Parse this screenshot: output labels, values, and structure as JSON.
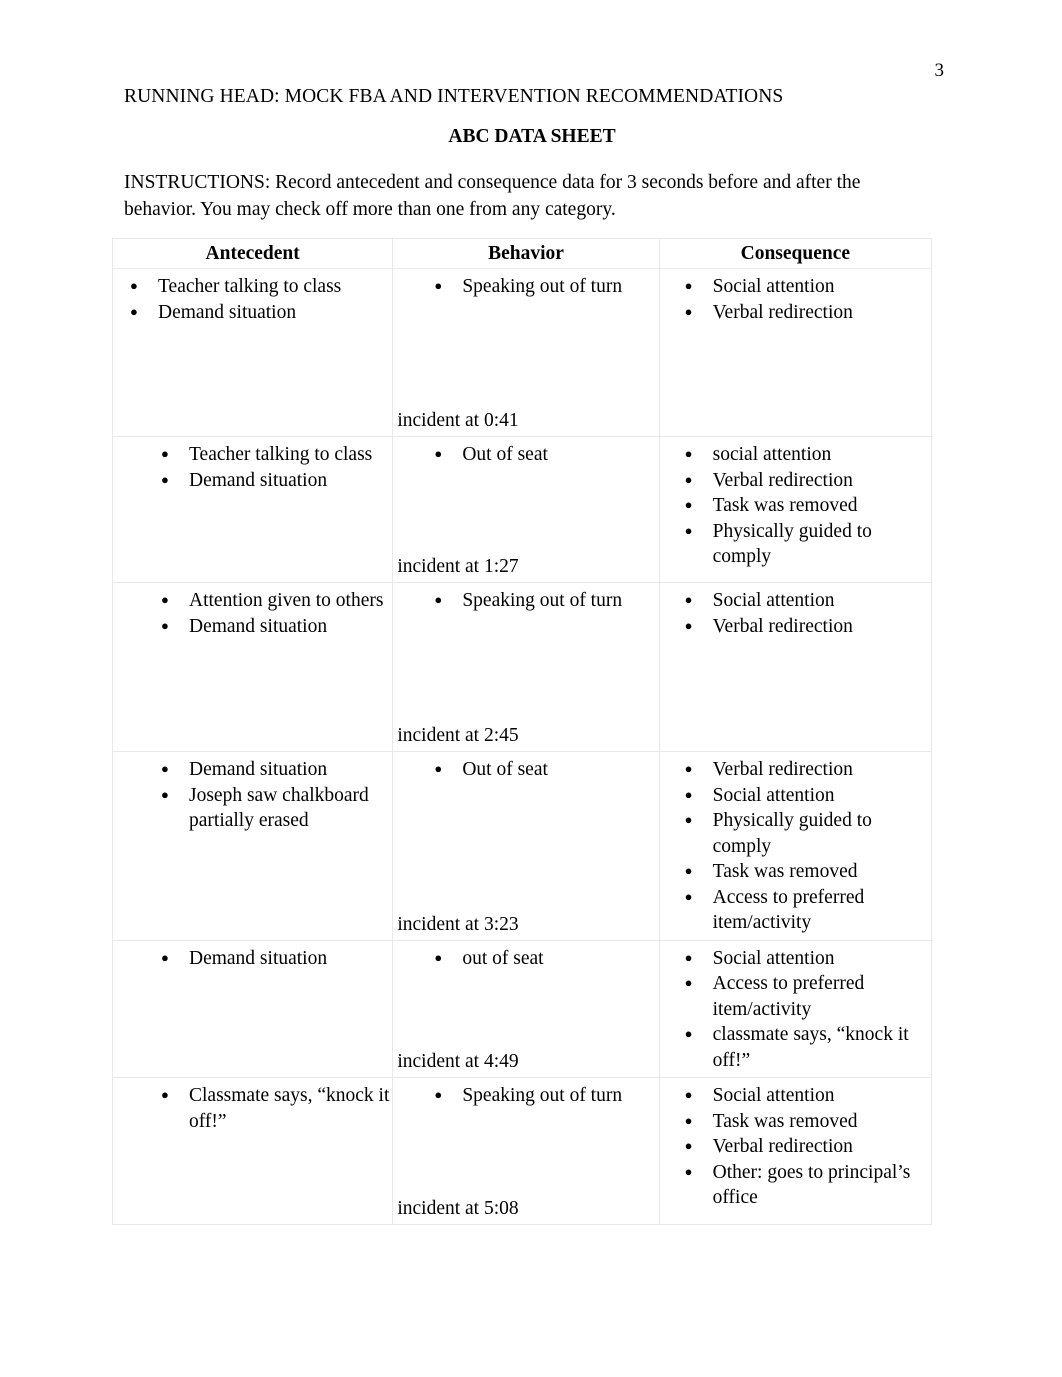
{
  "page": {
    "number": "3",
    "running_head": "RUNNING HEAD: MOCK FBA AND INTERVENTION RECOMMENDATIONS",
    "title": "ABC DATA SHEET",
    "instructions": "INSTRUCTIONS: Record antecedent and consequence data for 3 seconds before and after the behavior. You may check off more than one from any category."
  },
  "table": {
    "headers": {
      "antecedent": "Antecedent",
      "behavior": "Behavior",
      "consequence": "Consequence"
    },
    "rows": [
      {
        "antecedent": [
          "Teacher talking to class",
          "Demand situation"
        ],
        "behavior": [
          "Speaking out of turn"
        ],
        "incident": "incident at 0:41",
        "consequence": [
          " Social attention",
          "Verbal redirection"
        ]
      },
      {
        "antecedent": [
          "Teacher talking to class",
          "Demand situation"
        ],
        "behavior": [
          "Out of seat"
        ],
        "incident": "incident at 1:27",
        "consequence": [
          " social attention",
          "Verbal redirection",
          "Task was removed",
          "Physically guided to comply"
        ]
      },
      {
        "antecedent": [
          "Attention given to others",
          "Demand situation"
        ],
        "behavior": [
          "Speaking out of turn"
        ],
        "incident": "incident at 2:45",
        "consequence": [
          "Social attention",
          "Verbal redirection"
        ]
      },
      {
        "antecedent": [
          "Demand situation",
          "Joseph saw chalkboard partially erased"
        ],
        "behavior": [
          "Out of seat"
        ],
        "incident": "incident at 3:23",
        "consequence": [
          "Verbal redirection",
          "Social attention",
          "Physically guided to comply",
          "Task was removed",
          "Access to preferred item/activity"
        ]
      },
      {
        "antecedent": [
          "Demand situation"
        ],
        "behavior": [
          "out of seat"
        ],
        "incident": "incident at 4:49",
        "consequence": [
          "Social attention",
          "Access to preferred item/activity",
          "classmate says, “knock it off!”"
        ]
      },
      {
        "antecedent": [
          "Classmate says, “knock it off!”"
        ],
        "behavior": [
          "Speaking out of turn"
        ],
        "incident": "incident at 5:08",
        "consequence": [
          "Social attention",
          "Task was removed",
          "Verbal redirection",
          "Other: goes to principal’s office"
        ]
      }
    ]
  }
}
